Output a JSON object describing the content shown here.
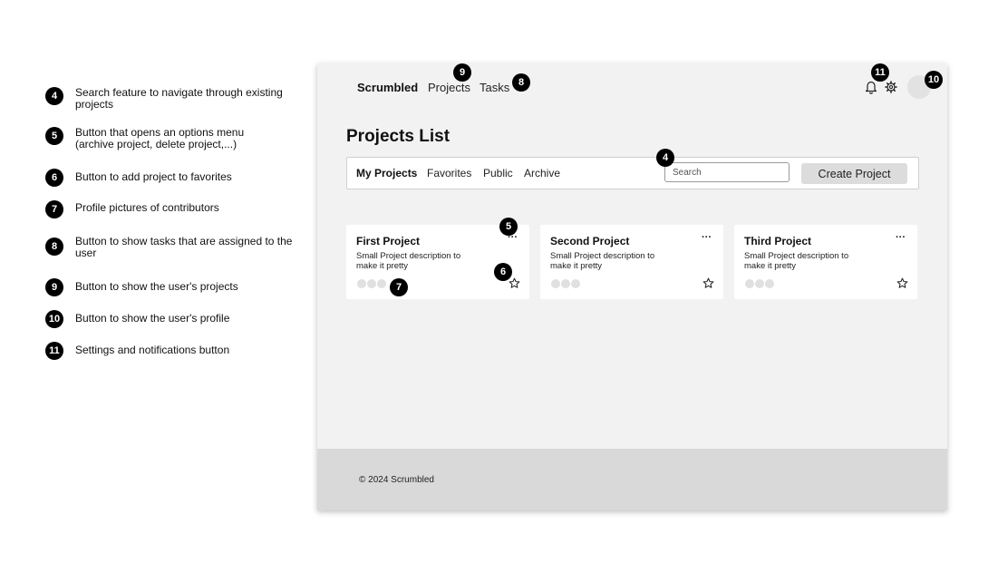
{
  "legend": [
    {
      "number": "4",
      "text": "Search feature to navigate through existing projects"
    },
    {
      "number": "5",
      "text": "Button that opens an options menu (archive project, delete project,...)"
    },
    {
      "number": "6",
      "text": "Button to add project to favorites"
    },
    {
      "number": "7",
      "text": "Profile pictures of contributors"
    },
    {
      "number": "8",
      "text": "Button to show tasks that are assigned to the user"
    },
    {
      "number": "9",
      "text": "Button to show the user's projects"
    },
    {
      "number": "10",
      "text": "Button to show the user's profile"
    },
    {
      "number": "11",
      "text": "Settings and notifications button"
    }
  ],
  "nav": {
    "brand": "Scrumbled",
    "projects": "Projects",
    "tasks": "Tasks"
  },
  "page": {
    "title": "Projects List"
  },
  "tabs": [
    {
      "label": "My Projects",
      "active": true
    },
    {
      "label": "Favorites",
      "active": false
    },
    {
      "label": "Public",
      "active": false
    },
    {
      "label": "Archive",
      "active": false
    }
  ],
  "search": {
    "placeholder": "Search",
    "value": ""
  },
  "create_button": "Create Project",
  "projects": [
    {
      "title": "First Project",
      "description": "Small Project description to make it pretty",
      "more": "···",
      "contributors": 3
    },
    {
      "title": "Second Project",
      "description": "Small Project description to make it pretty",
      "more": "···",
      "contributors": 3
    },
    {
      "title": "Third Project",
      "description": "Small Project description to make it pretty",
      "more": "···",
      "contributors": 3
    }
  ],
  "footer": {
    "text": "© 2024 Scrumbled"
  },
  "annotations": {
    "search": "4",
    "options": "5",
    "favorite": "6",
    "contributors": "7",
    "tasks": "8",
    "projects": "9",
    "profile": "10",
    "settings": "11"
  },
  "icons": {
    "notifications": "bell-icon",
    "settings": "gear-icon",
    "favorite": "star-icon",
    "options": "more-horizontal-icon"
  },
  "colors": {
    "badge": "#000000",
    "frame_bg": "#f2f2f2",
    "card_bg": "#ffffff",
    "footer_bg": "#d9d9d9",
    "button_bg": "#dcdcdc"
  }
}
